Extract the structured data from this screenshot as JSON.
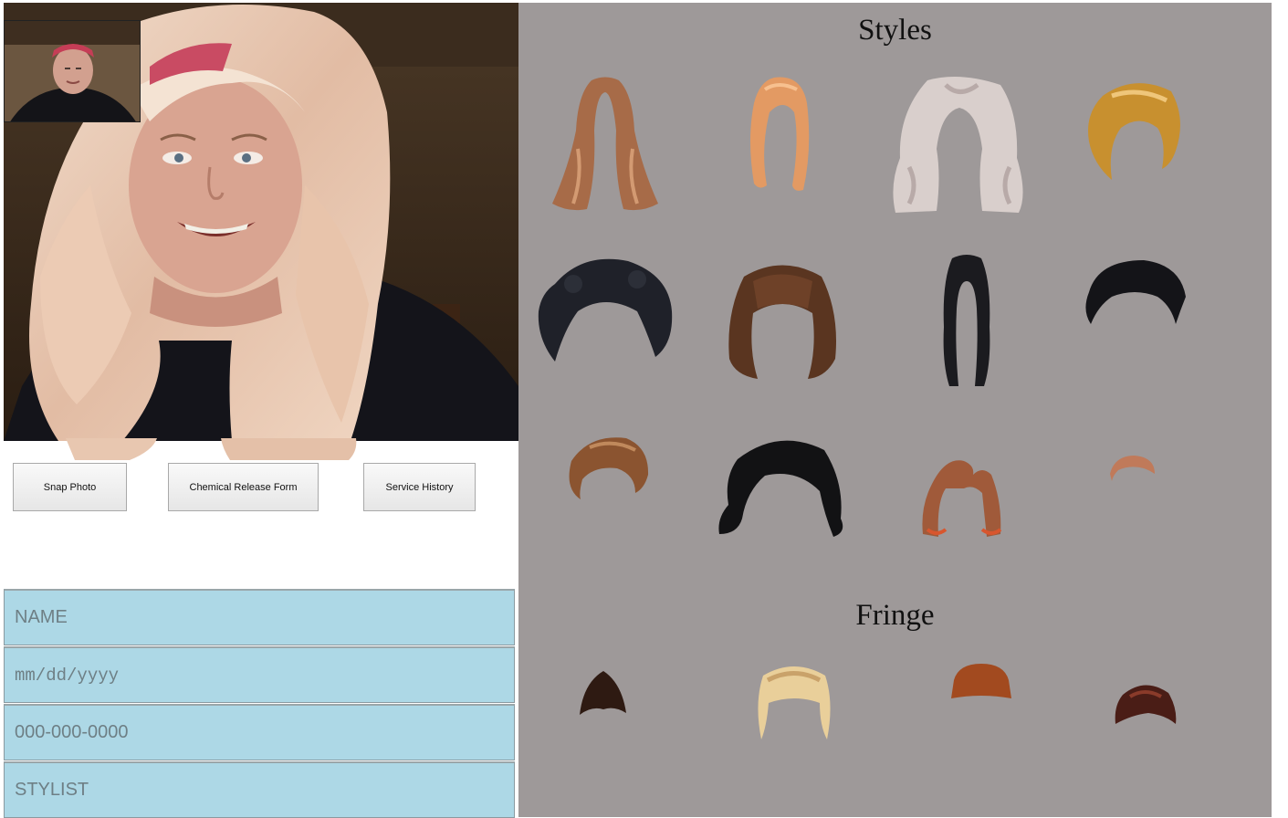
{
  "buttons": {
    "snap": "Snap Photo",
    "chemical": "Chemical Release Form",
    "history": "Service History"
  },
  "form": {
    "name_placeholder": "NAME",
    "date_placeholder": "mm/dd/yyyy",
    "phone_placeholder": "000-000-0000",
    "stylist_placeholder": "STYLIST"
  },
  "gallery": {
    "styles_title": "Styles",
    "fringe_title": "Fringe"
  },
  "colors": {
    "panel_bg": "#9e9999",
    "field_bg": "#add8e6",
    "applied_wig": "#e6c3a8"
  }
}
